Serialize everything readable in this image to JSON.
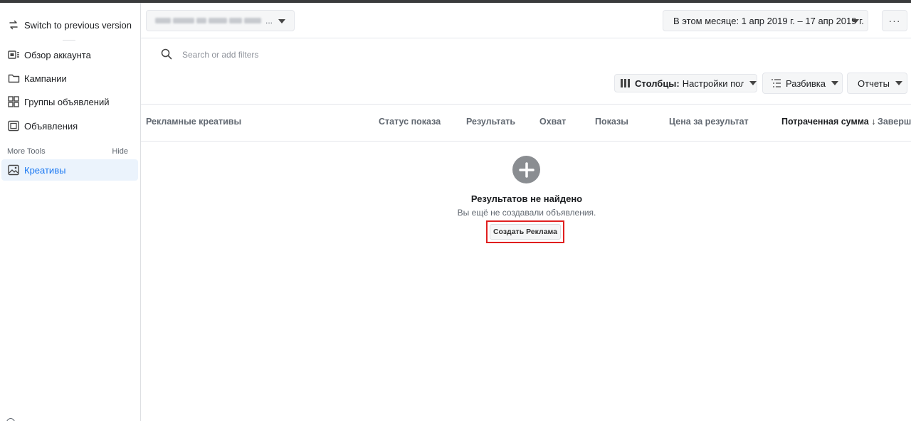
{
  "sidebar": {
    "switch_version": "Switch to previous version",
    "items": [
      {
        "label": "Обзор аккаунта",
        "icon": "account-overview-icon"
      },
      {
        "label": "Кампании",
        "icon": "folder-icon"
      },
      {
        "label": "Группы объявлений",
        "icon": "ad-sets-grid-icon"
      },
      {
        "label": "Объявления",
        "icon": "ads-icon"
      }
    ],
    "more_tools_label": "More Tools",
    "hide_label": "Hide",
    "active_item": {
      "label": "Креативы",
      "icon": "image-icon"
    }
  },
  "header": {
    "account_name_suffix": "...",
    "date_range": "В этом месяце: 1 апр 2019 г. – 17 апр 2019 г.",
    "more_label": "···"
  },
  "search": {
    "placeholder": "Search or add filters"
  },
  "toolbar": {
    "columns_label": "Столбцы:",
    "columns_value": "Настройки поль:",
    "breakdown_label": "Разбивка",
    "reports_label": "Отчеты"
  },
  "table": {
    "columns": [
      "Рекламные креативы",
      "Статус показа",
      "Результать",
      "Охват",
      "Показы",
      "Цена за результат",
      "Потраченная сумма ↓",
      "Заверше"
    ]
  },
  "empty_state": {
    "title": "Результатов не найдено",
    "subtitle": "Вы ещё не создавали объявления.",
    "create_button": "Создать Реклама"
  },
  "colors": {
    "accent": "#1877f2",
    "highlight_outline": "#e01f1f",
    "active_bg": "#ebf3fc"
  }
}
